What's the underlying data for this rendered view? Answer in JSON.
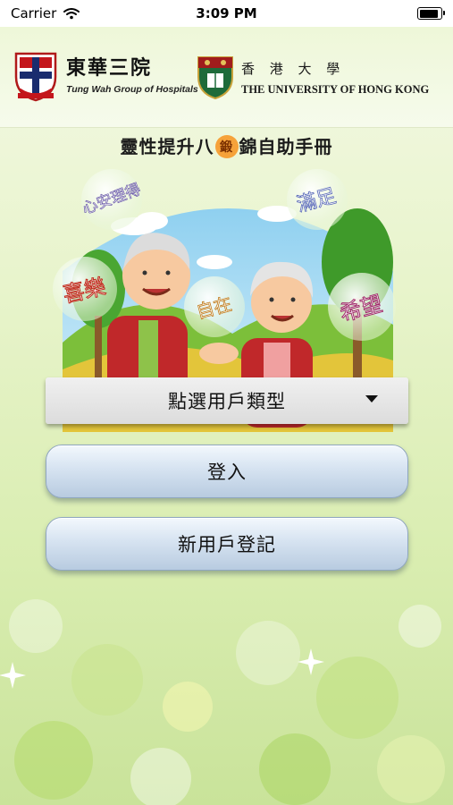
{
  "status_bar": {
    "carrier": "Carrier",
    "time": "3:09 PM",
    "battery_level": 0.9
  },
  "header": {
    "tungwah_name_cn": "東華三院",
    "tungwah_name_en": "Tung Wah Group of Hospitals",
    "hku_name_cn": "香 港 大 學",
    "hku_name_en": "THE UNIVERSITY OF HONG KONG"
  },
  "title": {
    "prefix": "靈性提升八",
    "circled_char": "鍛",
    "suffix": "錦自助手冊"
  },
  "illustration": {
    "bubbles": [
      "心安理得",
      "滿足",
      "喜樂",
      "自在",
      "希望"
    ]
  },
  "user_type_select": {
    "label": "點選用戶類型"
  },
  "buttons": {
    "login": "登入",
    "register": "新用戶登記"
  },
  "colors": {
    "accent_orange": "#f6a23a",
    "button_blue": "#c9d9ea",
    "background_green": "#e8f4cc"
  }
}
